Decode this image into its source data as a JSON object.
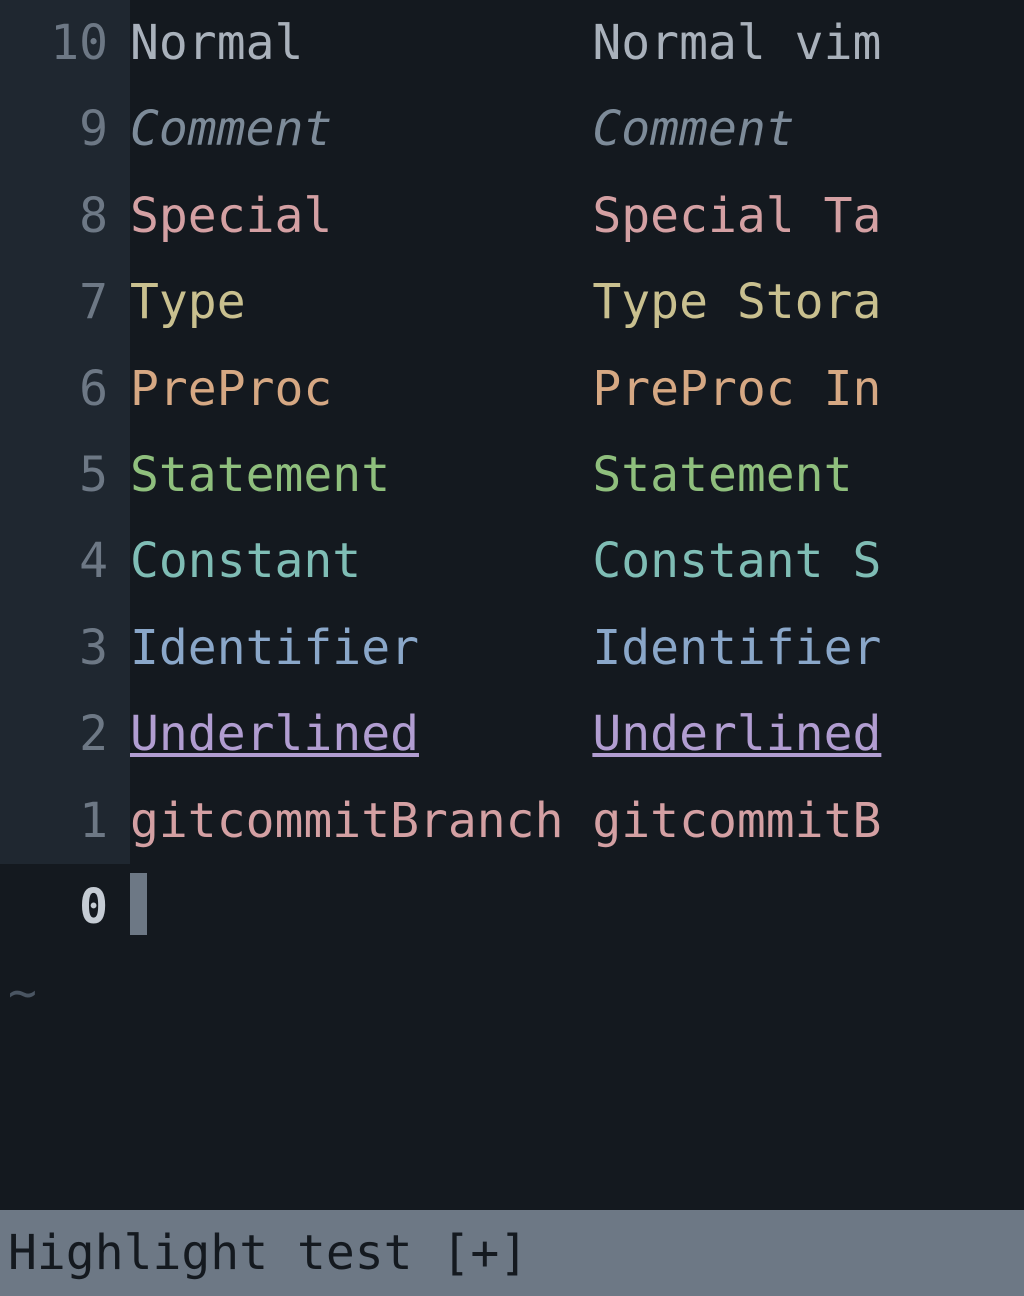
{
  "lines": [
    {
      "num": "10",
      "left": "Normal",
      "right": "Normal vim",
      "hl": "hl-normal"
    },
    {
      "num": "9",
      "left": "Comment",
      "right": "Comment",
      "hl": "hl-comment"
    },
    {
      "num": "8",
      "left": "Special",
      "right": "Special Ta",
      "hl": "hl-special"
    },
    {
      "num": "7",
      "left": "Type",
      "right": "Type Stora",
      "hl": "hl-type"
    },
    {
      "num": "6",
      "left": "PreProc",
      "right": "PreProc In",
      "hl": "hl-preproc"
    },
    {
      "num": "5",
      "left": "Statement",
      "right": "Statement ",
      "hl": "hl-statement"
    },
    {
      "num": "4",
      "left": "Constant",
      "right": "Constant S",
      "hl": "hl-constant"
    },
    {
      "num": "3",
      "left": "Identifier",
      "right": "Identifier",
      "hl": "hl-identifier"
    },
    {
      "num": "2",
      "left": "Underlined",
      "right": "Underlined",
      "hl": "hl-underlined"
    },
    {
      "num": "1",
      "left": "gitcommitBranch",
      "right": "gitcommitB",
      "hl": "hl-gitcommit"
    }
  ],
  "current_line_num": "0",
  "tilde": "~",
  "statusbar": "Highlight test [+]",
  "colors": {
    "bg": "#14191f",
    "gutter_bg": "#1f2730",
    "gutter_fg": "#6d7885",
    "status_bg": "#6d7885",
    "status_fg": "#14191f"
  }
}
